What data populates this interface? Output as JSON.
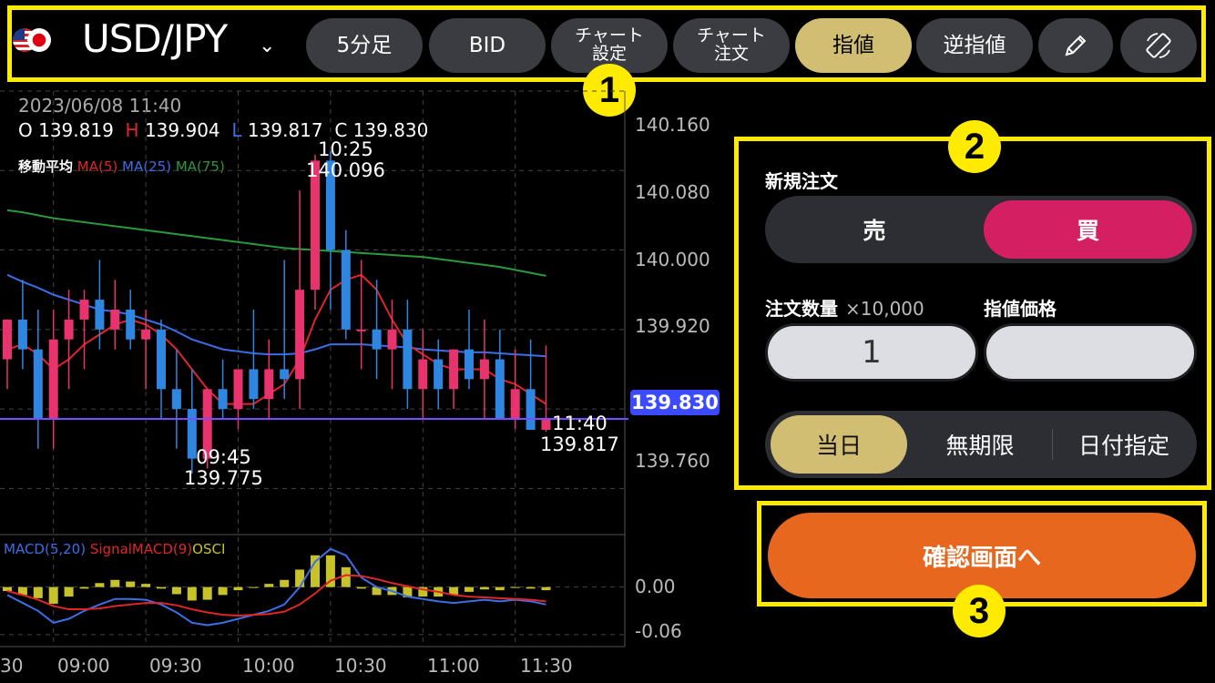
{
  "toolbar": {
    "pair": "USD/JPY",
    "buttons": {
      "timeframe": "5分足",
      "bid": "BID",
      "chart_settings": [
        "チャート",
        "設定"
      ],
      "chart_order": [
        "チャート",
        "注文"
      ],
      "limit": "指値",
      "stop": "逆指値"
    },
    "icons": [
      "flag-us-icon",
      "flag-jp-icon",
      "chevron-down-icon",
      "pencil-icon",
      "rotate-icon"
    ]
  },
  "chart": {
    "datetime": "2023/06/08 11:40",
    "ohlc": {
      "o_label": "O",
      "o": "139.819",
      "h_label": "H",
      "h": "139.904",
      "l_label": "L",
      "l": "139.817",
      "c_label": "C",
      "c": "139.830"
    },
    "ma_title": "移動平均",
    "ma": [
      "MA(5)",
      "MA(25)",
      "MA(75)"
    ],
    "high_annot": {
      "time": "10:25",
      "price": "140.096"
    },
    "low_annot": {
      "time": "09:45",
      "price": "139.775"
    },
    "last_annot": {
      "time": "11:40",
      "price": "139.817"
    },
    "current_price": "139.830",
    "y_labels": [
      "140.160",
      "140.080",
      "140.000",
      "139.920",
      "139.760"
    ],
    "macd_legend": [
      "MACD(5,20)",
      "SignalMACD(9)",
      "OSCI"
    ],
    "macd_y_labels": [
      "0.00",
      "-0.06"
    ],
    "x_labels": [
      "30",
      "09:00",
      "09:30",
      "10:00",
      "10:30",
      "11:00",
      "11:30"
    ],
    "colors": {
      "up": "#e8336f",
      "down": "#2f86e0",
      "ma5": "#e02626",
      "ma25": "#3a6fe8",
      "ma75": "#2a9a3a",
      "signal": "#e02626",
      "macd": "#3a6fe8",
      "osci": "#c8c22a",
      "price_line": "#7a4cff"
    }
  },
  "chart_data": {
    "type": "candlestick",
    "x": [
      "08:45",
      "08:50",
      "08:55",
      "09:00",
      "09:05",
      "09:10",
      "09:15",
      "09:20",
      "09:25",
      "09:30",
      "09:35",
      "09:40",
      "09:45",
      "09:50",
      "09:55",
      "10:00",
      "10:05",
      "10:10",
      "10:15",
      "10:20",
      "10:25",
      "10:30",
      "10:35",
      "10:40",
      "10:45",
      "10:50",
      "10:55",
      "11:00",
      "11:05",
      "11:10",
      "11:15",
      "11:20",
      "11:25",
      "11:30",
      "11:35",
      "11:40"
    ],
    "open": [
      139.89,
      139.93,
      139.9,
      139.83,
      139.91,
      139.93,
      139.95,
      139.92,
      139.94,
      139.91,
      139.92,
      139.86,
      139.84,
      139.79,
      139.86,
      139.84,
      139.88,
      139.85,
      139.88,
      139.87,
      139.96,
      140.09,
      140.0,
      139.92,
      139.92,
      139.9,
      139.92,
      139.86,
      139.89,
      139.86,
      139.9,
      139.87,
      139.89,
      139.83,
      139.86,
      139.819
    ],
    "high": [
      139.93,
      139.97,
      139.94,
      139.94,
      139.96,
      139.96,
      139.99,
      139.97,
      139.96,
      139.94,
      139.93,
      139.9,
      139.88,
      139.86,
      139.89,
      139.88,
      139.94,
      139.91,
      139.99,
      140.06,
      140.096,
      140.1,
      140.02,
      139.99,
      139.97,
      139.95,
      139.95,
      139.92,
      139.91,
      139.9,
      139.94,
      139.93,
      139.92,
      139.9,
      139.91,
      139.904
    ],
    "low": [
      139.86,
      139.88,
      139.8,
      139.8,
      139.86,
      139.88,
      139.9,
      139.9,
      139.9,
      139.86,
      139.83,
      139.8,
      139.775,
      139.78,
      139.83,
      139.82,
      139.84,
      139.83,
      139.85,
      139.84,
      139.94,
      139.94,
      139.91,
      139.88,
      139.87,
      139.86,
      139.84,
      139.83,
      139.84,
      139.84,
      139.86,
      139.83,
      139.84,
      139.82,
      139.82,
      139.817
    ],
    "close": [
      139.93,
      139.9,
      139.83,
      139.91,
      139.93,
      139.95,
      139.92,
      139.94,
      139.91,
      139.92,
      139.86,
      139.84,
      139.79,
      139.86,
      139.84,
      139.88,
      139.85,
      139.88,
      139.87,
      139.96,
      140.09,
      140.0,
      139.92,
      139.92,
      139.9,
      139.92,
      139.86,
      139.89,
      139.86,
      139.9,
      139.87,
      139.89,
      139.83,
      139.86,
      139.819,
      139.83
    ],
    "ma5": [
      139.9,
      139.905,
      139.895,
      139.88,
      139.89,
      139.905,
      139.915,
      139.925,
      139.93,
      139.925,
      139.915,
      139.9,
      139.88,
      139.86,
      139.845,
      139.845,
      139.845,
      139.855,
      139.865,
      139.89,
      139.93,
      139.96,
      139.97,
      139.975,
      139.96,
      139.93,
      139.905,
      139.895,
      139.885,
      139.88,
      139.88,
      139.88,
      139.87,
      139.865,
      139.855,
      139.845
    ],
    "ma25": [
      139.975,
      139.968,
      139.962,
      139.955,
      139.95,
      139.945,
      139.94,
      139.938,
      139.935,
      139.93,
      139.925,
      139.918,
      139.91,
      139.905,
      139.9,
      139.898,
      139.896,
      139.895,
      139.895,
      139.896,
      139.9,
      139.905,
      139.905,
      139.905,
      139.904,
      139.903,
      139.902,
      139.9,
      139.899,
      139.898,
      139.897,
      139.897,
      139.896,
      139.895,
      139.894,
      139.893
    ],
    "ma75": [
      140.04,
      140.038,
      140.035,
      140.032,
      140.03,
      140.028,
      140.026,
      140.024,
      140.022,
      140.02,
      140.018,
      140.016,
      140.014,
      140.012,
      140.01,
      140.008,
      140.006,
      140.004,
      140.002,
      140.001,
      140.0,
      139.999,
      139.998,
      139.997,
      139.996,
      139.995,
      139.994,
      139.993,
      139.991,
      139.989,
      139.987,
      139.985,
      139.983,
      139.98,
      139.977,
      139.974
    ],
    "macd": [
      -0.01,
      -0.02,
      -0.03,
      -0.045,
      -0.04,
      -0.03,
      -0.022,
      -0.015,
      -0.015,
      -0.016,
      -0.022,
      -0.032,
      -0.045,
      -0.048,
      -0.045,
      -0.04,
      -0.035,
      -0.03,
      -0.022,
      0.0,
      0.032,
      0.048,
      0.04,
      0.012,
      0.0,
      -0.005,
      -0.012,
      -0.015,
      -0.018,
      -0.02,
      -0.018,
      -0.016,
      -0.018,
      -0.016,
      -0.018,
      -0.022
    ],
    "signal": [
      -0.005,
      -0.01,
      -0.016,
      -0.024,
      -0.028,
      -0.028,
      -0.027,
      -0.024,
      -0.022,
      -0.02,
      -0.02,
      -0.023,
      -0.028,
      -0.032,
      -0.035,
      -0.036,
      -0.035,
      -0.034,
      -0.031,
      -0.022,
      -0.008,
      0.008,
      0.015,
      0.014,
      0.01,
      0.005,
      0.001,
      -0.003,
      -0.006,
      -0.01,
      -0.012,
      -0.013,
      -0.014,
      -0.015,
      -0.016,
      -0.018
    ],
    "osci": [
      -0.005,
      -0.01,
      -0.014,
      -0.021,
      -0.012,
      -0.002,
      0.005,
      0.009,
      0.007,
      0.004,
      -0.002,
      -0.009,
      -0.017,
      -0.016,
      -0.01,
      -0.004,
      0.0,
      0.004,
      0.009,
      0.022,
      0.04,
      0.04,
      0.025,
      -0.002,
      -0.01,
      -0.01,
      -0.013,
      -0.012,
      -0.012,
      -0.01,
      -0.006,
      -0.003,
      -0.004,
      -0.001,
      -0.002,
      -0.004
    ],
    "ylim": [
      139.72,
      140.16
    ],
    "macd_ylim": [
      -0.075,
      0.065
    ],
    "x_tick_labels": [
      "30",
      "09:00",
      "09:30",
      "10:00",
      "10:30",
      "11:00",
      "11:30"
    ]
  },
  "panel": {
    "title": "新規注文",
    "sell": "売",
    "buy": "買",
    "qty_label": "注文数量",
    "qty_unit": "×10,000",
    "price_label": "指値価格",
    "qty_value": "1",
    "price_value": "",
    "exp": [
      "当日",
      "無期限",
      "日付指定"
    ],
    "confirm": "確認画面へ"
  },
  "badges": [
    "1",
    "2",
    "3"
  ]
}
